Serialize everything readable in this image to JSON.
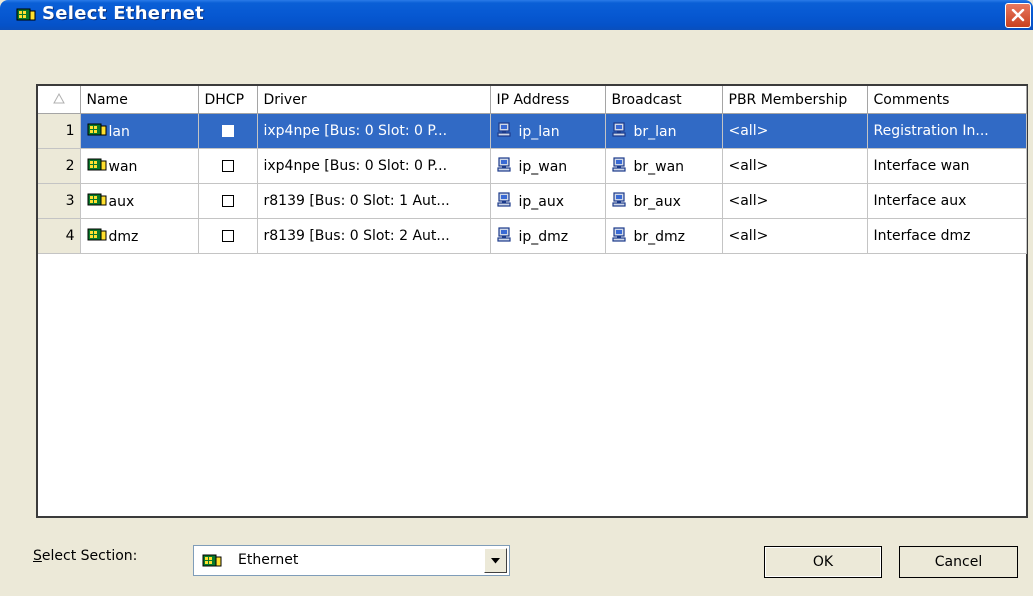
{
  "window": {
    "title": "Select Ethernet"
  },
  "grid": {
    "columns": [
      "Name",
      "DHCP",
      "Driver",
      "IP Address",
      "Broadcast",
      "PBR Membership",
      "Comments"
    ],
    "rows": [
      {
        "num": "1",
        "name": "lan",
        "dhcp": false,
        "driver": "ixp4npe [Bus: 0 Slot: 0 P...",
        "ip": "ip_lan",
        "broadcast": "br_lan",
        "pbr": "<all>",
        "comments": "Registration In...",
        "selected": true
      },
      {
        "num": "2",
        "name": "wan",
        "dhcp": false,
        "driver": "ixp4npe [Bus: 0 Slot: 0 P...",
        "ip": "ip_wan",
        "broadcast": "br_wan",
        "pbr": "<all>",
        "comments": "Interface wan",
        "selected": false
      },
      {
        "num": "3",
        "name": "aux",
        "dhcp": false,
        "driver": "r8139 [Bus: 0 Slot: 1 Aut...",
        "ip": "ip_aux",
        "broadcast": "br_aux",
        "pbr": "<all>",
        "comments": "Interface aux",
        "selected": false
      },
      {
        "num": "4",
        "name": "dmz",
        "dhcp": false,
        "driver": "r8139 [Bus: 0 Slot: 2 Aut...",
        "ip": "ip_dmz",
        "broadcast": "br_dmz",
        "pbr": "<all>",
        "comments": "Interface dmz",
        "selected": false
      }
    ]
  },
  "footer": {
    "section_label": "Select Section:",
    "section_value": "Ethernet",
    "ok_label": "OK",
    "cancel_label": "Cancel"
  },
  "icons": {
    "title": "network-card-icon",
    "row": "network-card-icon",
    "address": "computer-icon",
    "sort": "sort-indicator-icon",
    "dropdown": "dropdown-arrow-icon",
    "close": "close-icon"
  },
  "colors": {
    "titlebar": "#0758d2",
    "selection": "#316ac5",
    "dialog_bg": "#ece9d8",
    "close_button": "#c8401e"
  }
}
